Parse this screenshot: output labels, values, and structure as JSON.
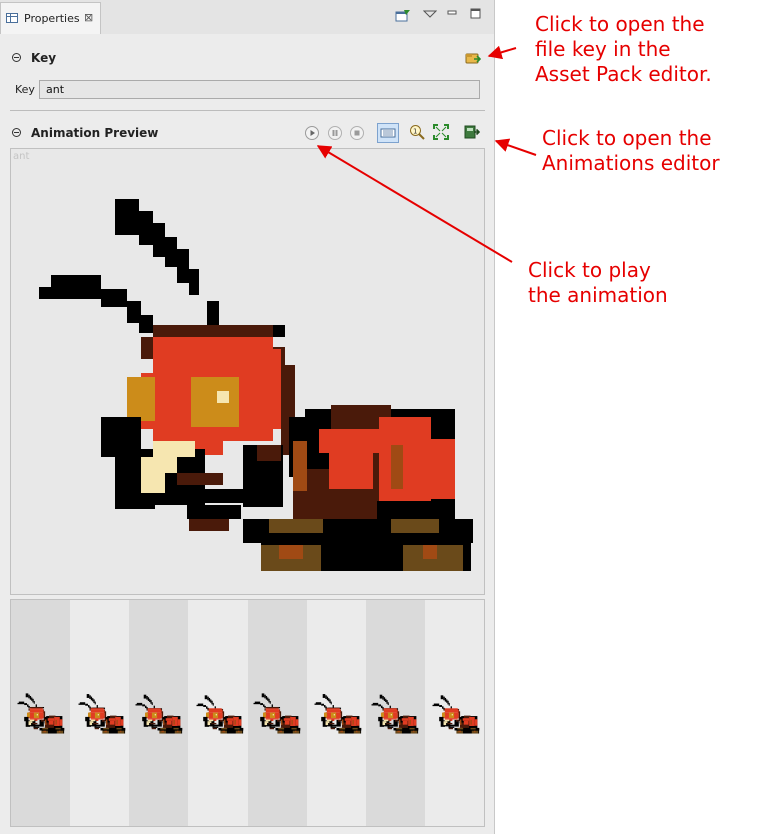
{
  "tab": {
    "title": "Properties",
    "close": "⊠"
  },
  "key_section": {
    "title": "Key",
    "label": "Key",
    "value": "ant"
  },
  "preview_section": {
    "title": "Animation Preview",
    "canvas_label": "ant"
  },
  "frames": {
    "count": 8
  },
  "callouts": {
    "asset_pack": "Click to open the\nfile key in the\nAsset Pack editor.",
    "animations": "Click to open the\nAnimations editor",
    "play": "Click to play\nthe animation"
  },
  "colors": {
    "annotation": "#e60000",
    "panel": "#ececec",
    "selected_tool": "#cfe3f8"
  }
}
